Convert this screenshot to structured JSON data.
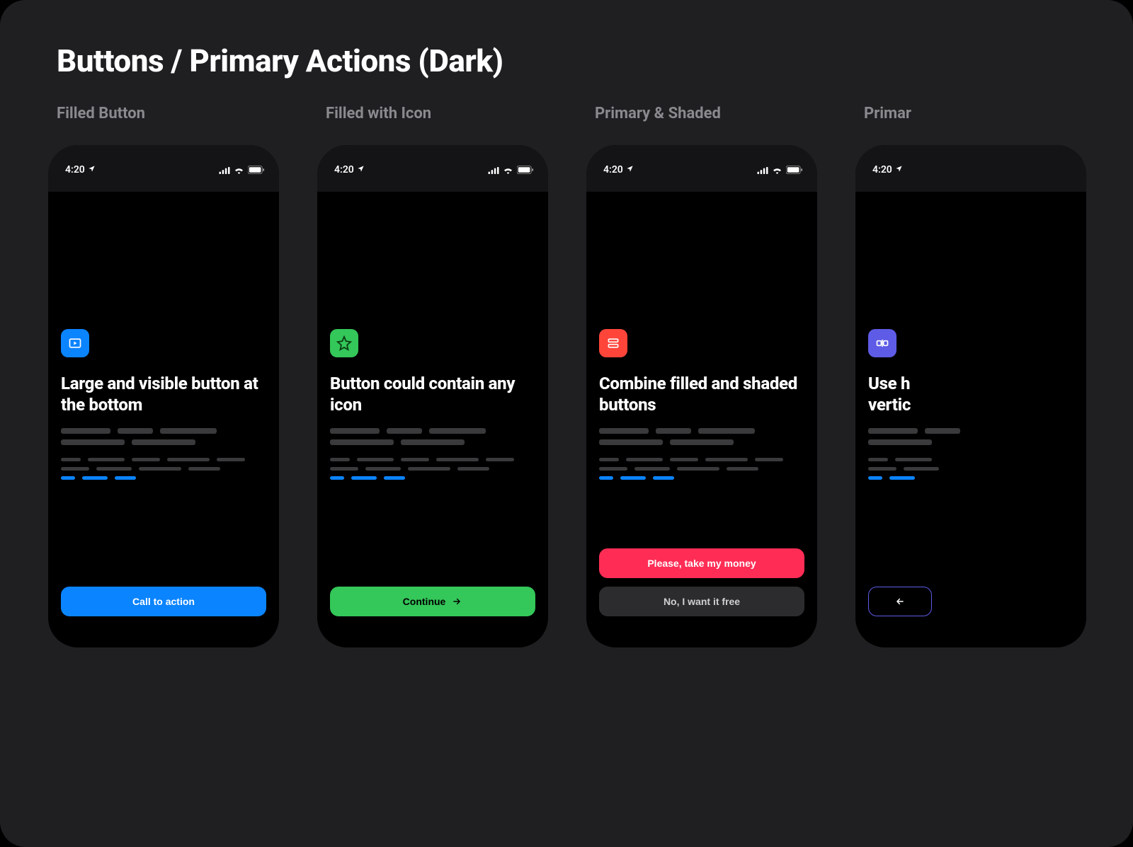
{
  "page": {
    "title": "Buttons / Primary Actions (Dark)"
  },
  "status": {
    "time": "4:20"
  },
  "sections": [
    {
      "label": "Filled Button"
    },
    {
      "label": "Filled with Icon"
    },
    {
      "label": "Primary & Shaded"
    },
    {
      "label": "Primar"
    }
  ],
  "cards": {
    "c1": {
      "title": "Large and visible button at the bottom",
      "cta": "Call to action"
    },
    "c2": {
      "title": "Button could contain any icon",
      "cta": "Continue"
    },
    "c3": {
      "title": "Combine filled and shaded buttons",
      "primary": "Please, take my money",
      "secondary": "No, I want it free"
    },
    "c4": {
      "title": "Use h\nvertic"
    }
  },
  "colors": {
    "blue": "#0b84ff",
    "green": "#34c759",
    "red": "#ff453a",
    "purple": "#5e5ce6",
    "pink": "#ff2d55",
    "shaded": "#2c2c2e"
  }
}
